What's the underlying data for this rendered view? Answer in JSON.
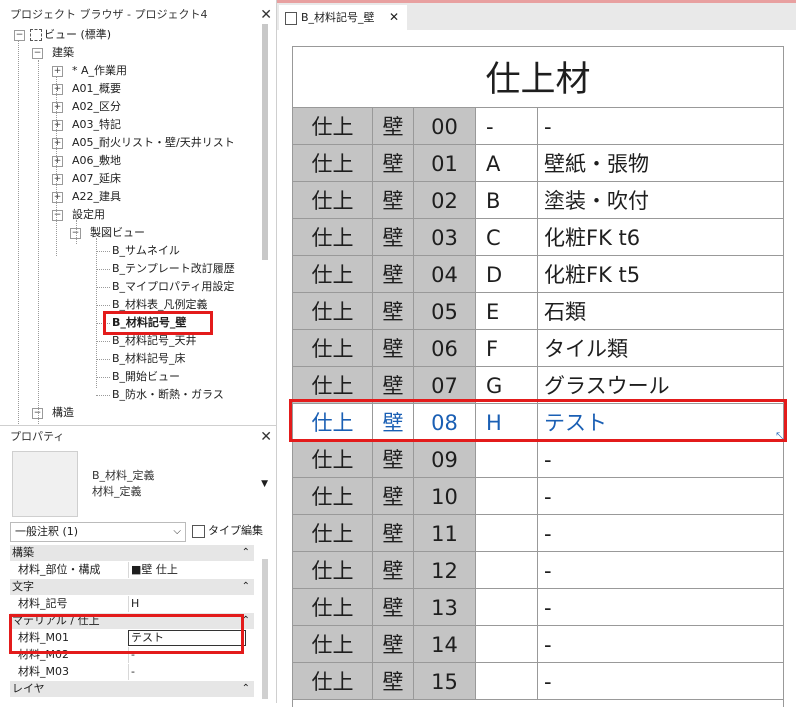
{
  "project_browser": {
    "title": "プロジェクト ブラウザ - プロジェクト4",
    "tree": [
      {
        "label": "ビュー (標準)",
        "toggle": "−"
      },
      {
        "label": "建築",
        "toggle": "−"
      },
      {
        "label": "* A_作業用",
        "toggle": "+"
      },
      {
        "label": "A01_概要",
        "toggle": "+"
      },
      {
        "label": "A02_区分",
        "toggle": "+"
      },
      {
        "label": "A03_特記",
        "toggle": "+"
      },
      {
        "label": "A05_耐火リスト・壁/天井リスト",
        "toggle": "+"
      },
      {
        "label": "A06_敷地",
        "toggle": "+"
      },
      {
        "label": "A07_延床",
        "toggle": "+"
      },
      {
        "label": "A22_建具",
        "toggle": "+"
      },
      {
        "label": "設定用",
        "toggle": "−"
      },
      {
        "label": "製図ビュー",
        "toggle": "−"
      },
      {
        "label": "B_サムネイル"
      },
      {
        "label": "B_テンプレート改訂履歴"
      },
      {
        "label": "B_マイプロパティ用設定"
      },
      {
        "label": "B_材料表_凡例定義"
      },
      {
        "label": "B_材料記号_壁"
      },
      {
        "label": "B_材料記号_天井"
      },
      {
        "label": "B_材料記号_床"
      },
      {
        "label": "B_開始ビュー"
      },
      {
        "label": "B_防水・断熱・ガラス"
      },
      {
        "label": "構造",
        "toggle": "−"
      }
    ]
  },
  "properties": {
    "title": "プロパティ",
    "type_line1": "B_材料_定義",
    "type_line2": "材料_定義",
    "instance_selector": "一般注釈 (1)",
    "edit_type_label": "タイプ編集",
    "groups": [
      {
        "name": "構築",
        "rows": [
          {
            "key": "材料_部位・構成",
            "value": "■壁 仕上"
          }
        ]
      },
      {
        "name": "文字",
        "rows": [
          {
            "key": "材料_記号",
            "value": "H"
          }
        ]
      },
      {
        "name": "マテリアル / 仕上",
        "rows": [
          {
            "key": "材料_M01",
            "value": "テスト"
          },
          {
            "key": "材料_M02",
            "value": "-"
          },
          {
            "key": "材料_M03",
            "value": "-"
          }
        ]
      },
      {
        "name": "レイヤ",
        "rows": []
      }
    ]
  },
  "view_tab": {
    "label": "B_材料記号_壁",
    "close": "✕"
  },
  "schedule": {
    "title": "仕上材",
    "rows": [
      [
        "仕上",
        "壁",
        "00",
        "-",
        "-"
      ],
      [
        "仕上",
        "壁",
        "01",
        "A",
        "壁紙・張物"
      ],
      [
        "仕上",
        "壁",
        "02",
        "B",
        "塗装・吹付"
      ],
      [
        "仕上",
        "壁",
        "03",
        "C",
        "化粧FK t6"
      ],
      [
        "仕上",
        "壁",
        "04",
        "D",
        "化粧FK t5"
      ],
      [
        "仕上",
        "壁",
        "05",
        "E",
        "石類"
      ],
      [
        "仕上",
        "壁",
        "06",
        "F",
        "タイル類"
      ],
      [
        "仕上",
        "壁",
        "07",
        "G",
        "グラスウール"
      ],
      [
        "仕上",
        "壁",
        "08",
        "H",
        "テスト"
      ],
      [
        "仕上",
        "壁",
        "09",
        "",
        "-"
      ],
      [
        "仕上",
        "壁",
        "10",
        "",
        "-"
      ],
      [
        "仕上",
        "壁",
        "11",
        "",
        "-"
      ],
      [
        "仕上",
        "壁",
        "12",
        "",
        "-"
      ],
      [
        "仕上",
        "壁",
        "13",
        "",
        "-"
      ],
      [
        "仕上",
        "壁",
        "14",
        "",
        "-"
      ],
      [
        "仕上",
        "壁",
        "15",
        "",
        "-"
      ]
    ],
    "selected_row": 8
  },
  "colors": {
    "highlight_red": "#e31b1b",
    "selected_text": "#1a5fb4",
    "cell_gray": "#c4c4c4"
  }
}
